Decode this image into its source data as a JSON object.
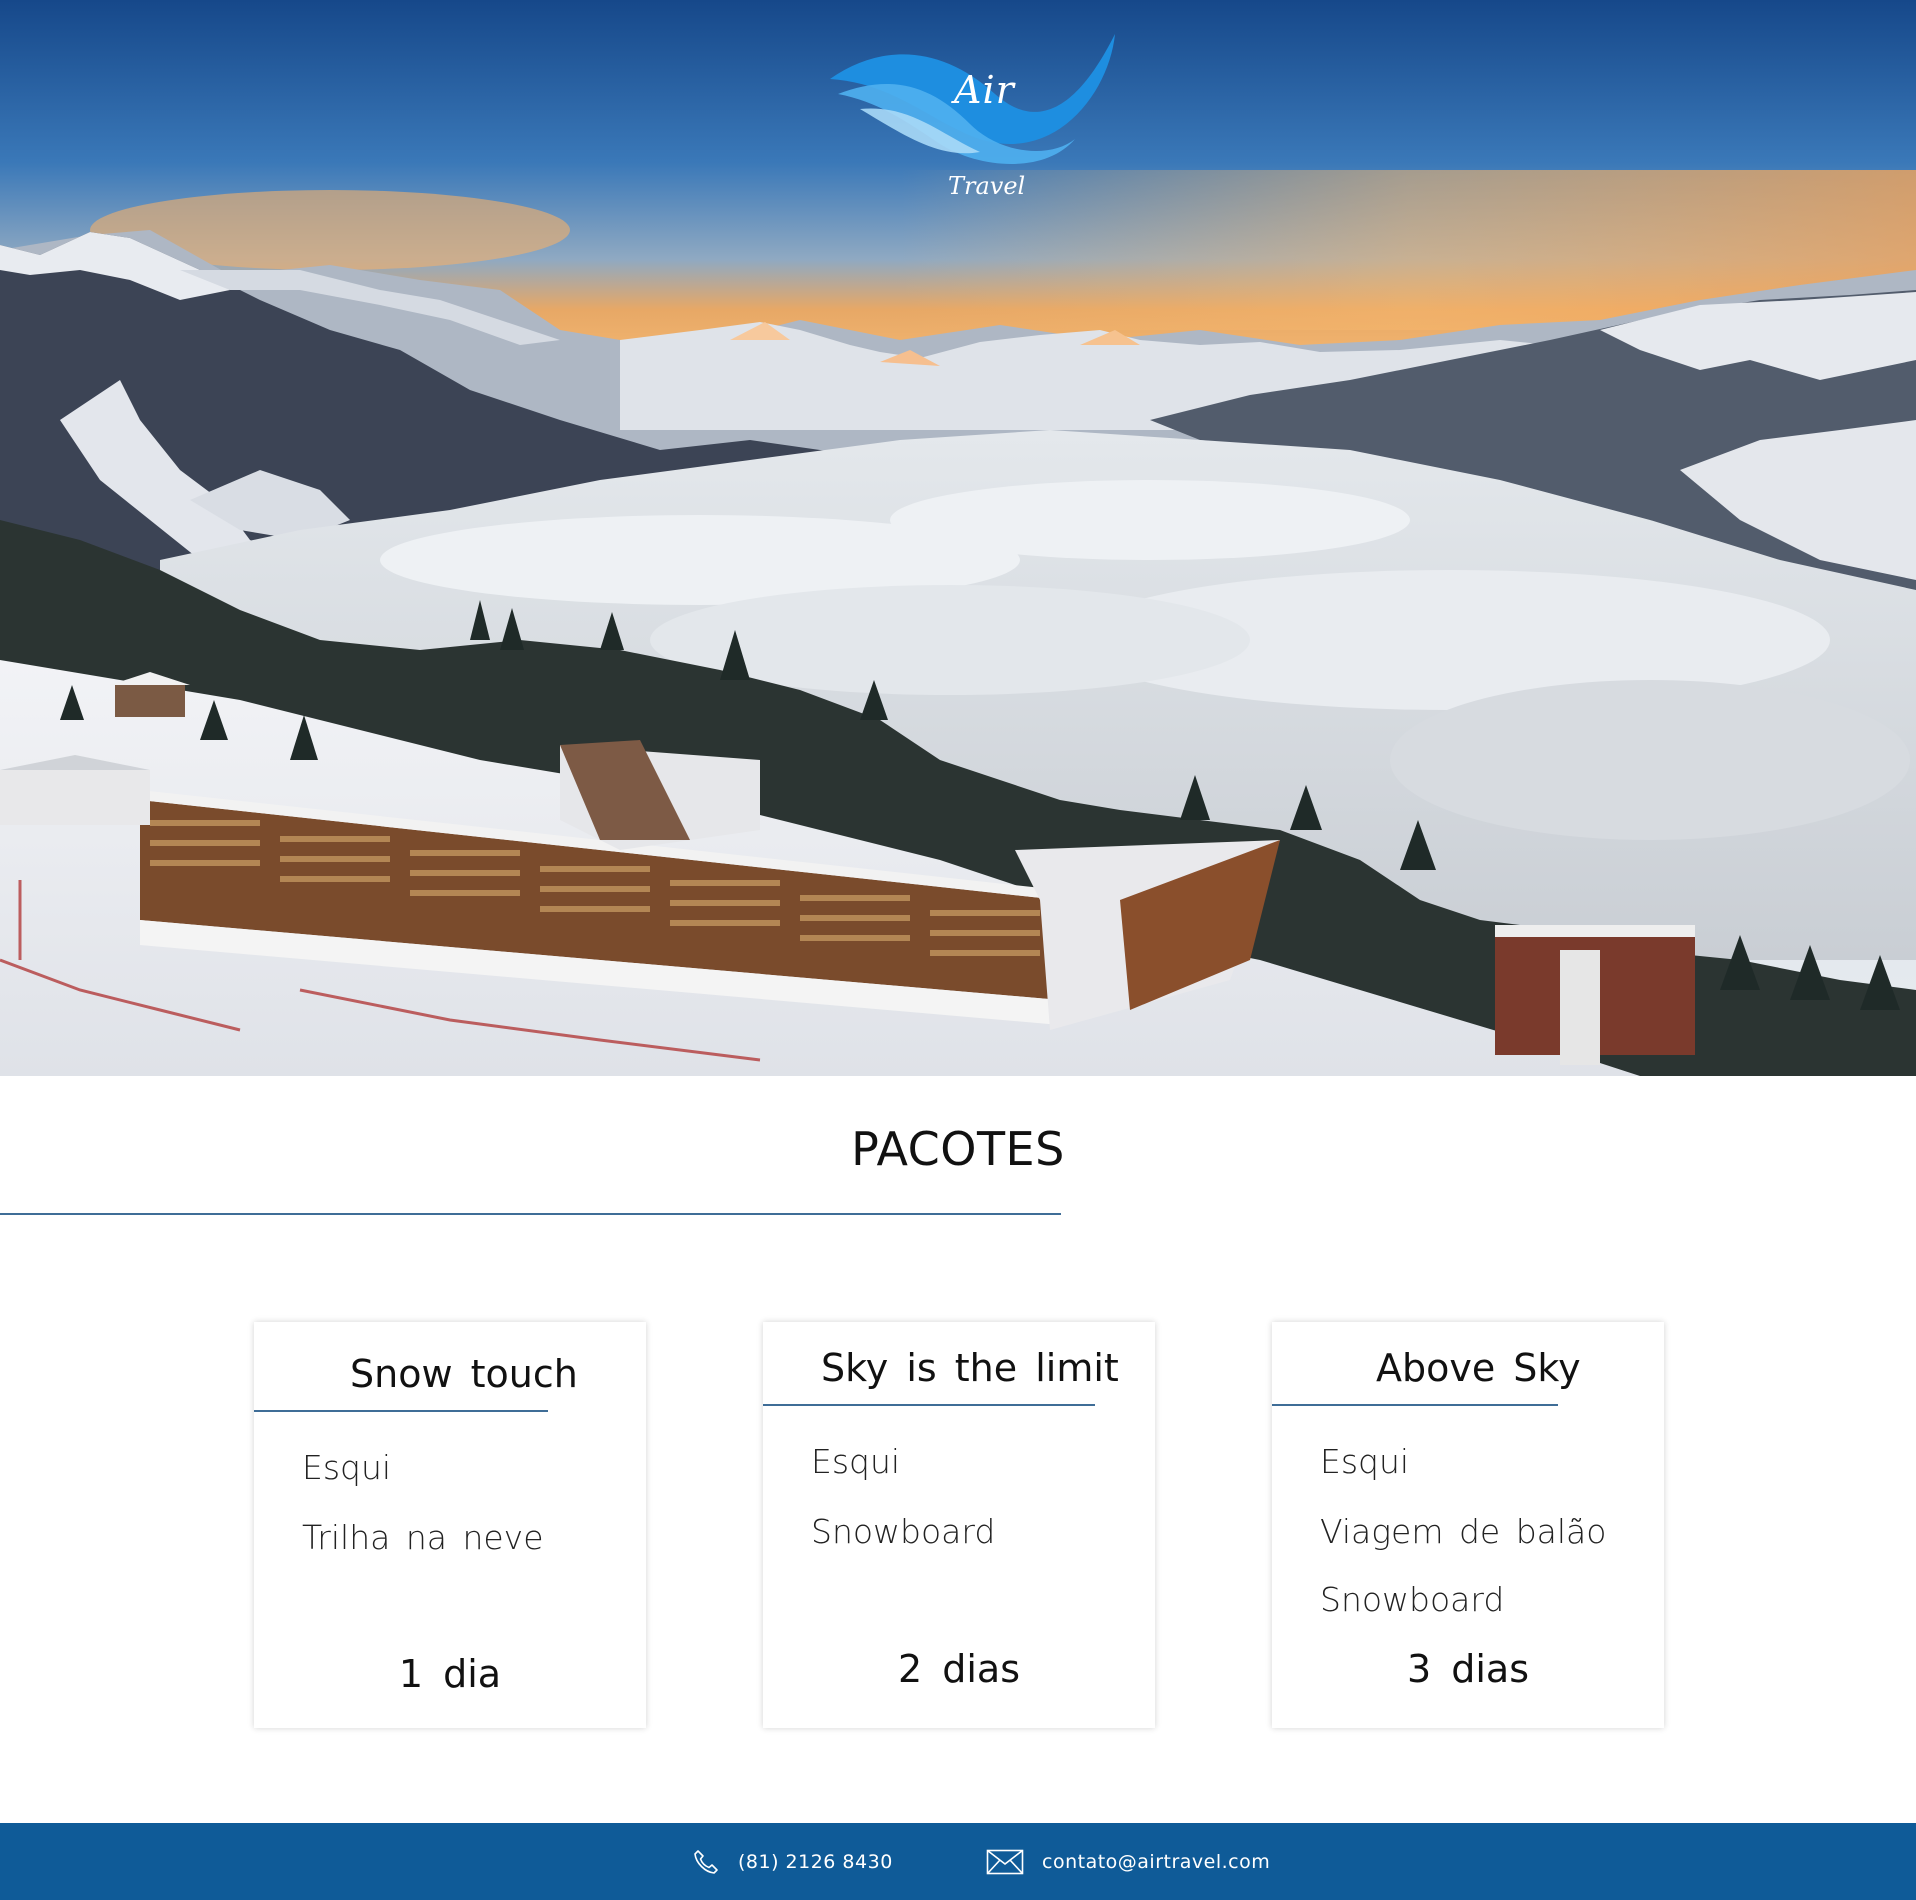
{
  "brand": {
    "logo_word": "Air",
    "logo_sub": "Travel"
  },
  "section": {
    "title": "PACOTES"
  },
  "packages": [
    {
      "title": "Snow touch",
      "items": [
        "Esqui",
        "Trilha na neve"
      ],
      "duration": "1 dia"
    },
    {
      "title": "Sky is the limit",
      "items": [
        "Esqui",
        "Snowboard"
      ],
      "duration": "2 dias"
    },
    {
      "title": "Above Sky",
      "items": [
        "Esqui",
        "Viagem de balão",
        "Snowboard"
      ],
      "duration": "3 dias"
    }
  ],
  "footer": {
    "phone": "(81) 2126 8430",
    "email": "contato@airtravel.com"
  },
  "colors": {
    "accent": "#0f5b98",
    "rule": "#3f6d97"
  },
  "icons": {
    "phone": "phone-icon",
    "email": "envelope-icon"
  }
}
